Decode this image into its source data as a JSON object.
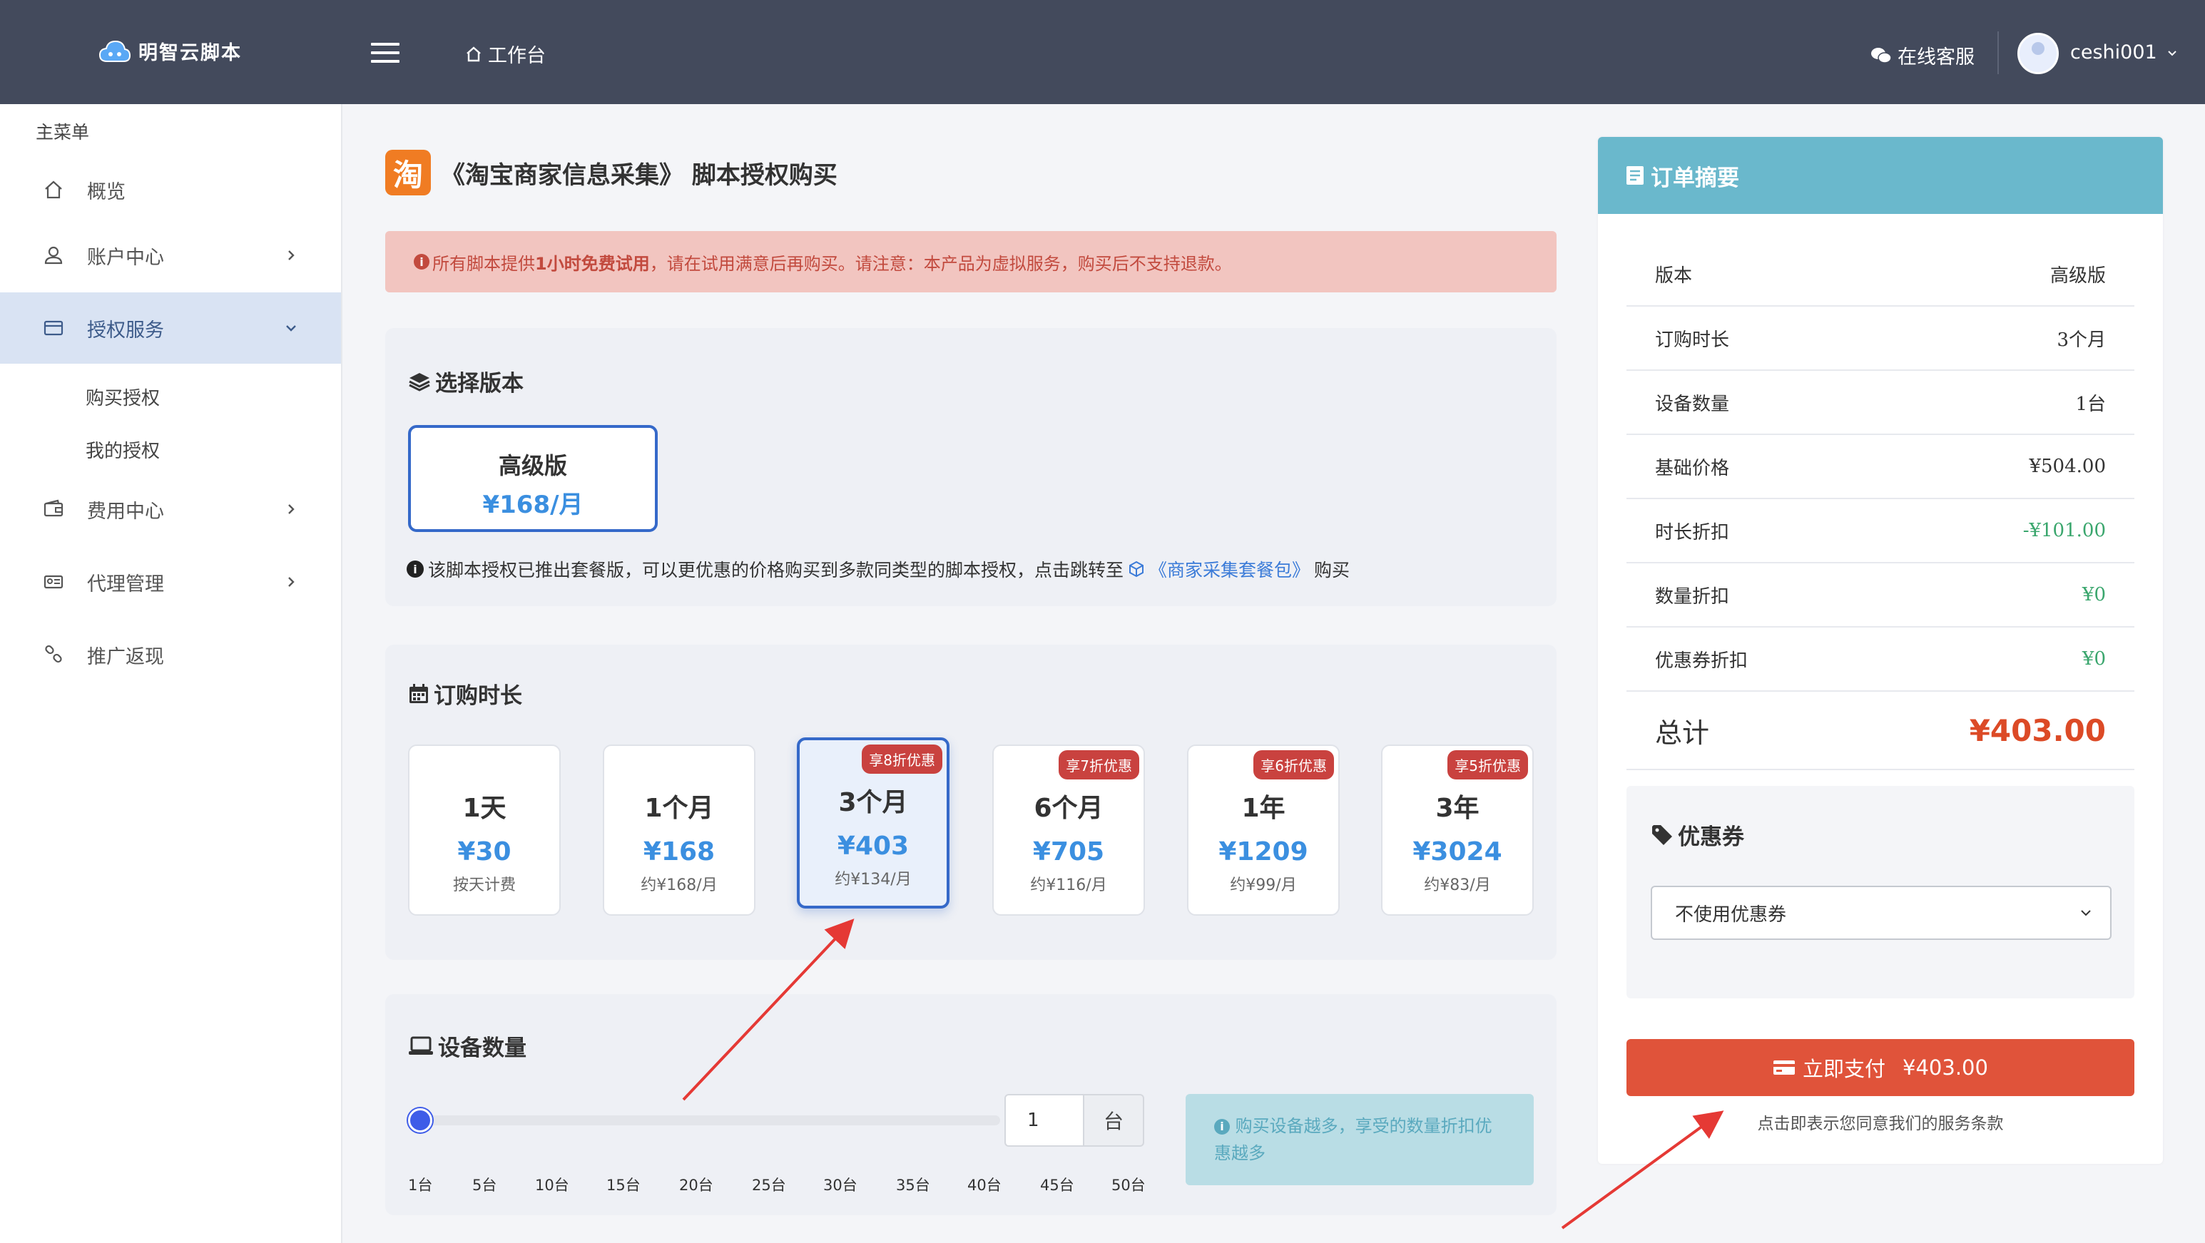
{
  "header": {
    "brand": "明智云脚本",
    "workbench": "工作台",
    "support": "在线客服",
    "username": "ceshi001"
  },
  "sidebar": {
    "title": "主菜单",
    "items": [
      {
        "label": "概览"
      },
      {
        "label": "账户中心"
      },
      {
        "label": "授权服务"
      },
      {
        "label": "费用中心"
      },
      {
        "label": "代理管理"
      },
      {
        "label": "推广返现"
      }
    ],
    "sub_items": [
      {
        "label": "购买授权"
      },
      {
        "label": "我的授权"
      }
    ]
  },
  "page": {
    "logo_char": "淘",
    "title": "《淘宝商家信息采集》 脚本授权购买"
  },
  "alert": {
    "prefix": "所有脚本提供",
    "bold": "1小时免费试用",
    "suffix": "，请在试用满意后再购买。请注意：本产品为虚拟服务，购买后不支持退款。"
  },
  "version": {
    "section_title": "选择版本",
    "name": "高级版",
    "price": "¥168/月",
    "note_prefix": "该脚本授权已推出套餐版，可以更优惠的价格购买到多款同类型的脚本授权，点击跳转至",
    "note_link": "《商家采集套餐包》",
    "note_suffix": "购买"
  },
  "duration": {
    "section_title": "订购时长",
    "options": [
      {
        "label": "1天",
        "price": "¥30",
        "sub": "按天计费",
        "badge": ""
      },
      {
        "label": "1个月",
        "price": "¥168",
        "sub": "约¥168/月",
        "badge": ""
      },
      {
        "label": "3个月",
        "price": "¥403",
        "sub": "约¥134/月",
        "badge": "享8折优惠"
      },
      {
        "label": "6个月",
        "price": "¥705",
        "sub": "约¥116/月",
        "badge": "享7折优惠"
      },
      {
        "label": "1年",
        "price": "¥1209",
        "sub": "约¥99/月",
        "badge": "享6折优惠"
      },
      {
        "label": "3年",
        "price": "¥3024",
        "sub": "约¥83/月",
        "badge": "享5折优惠"
      }
    ],
    "selected_index": 2
  },
  "devices": {
    "section_title": "设备数量",
    "value": "1",
    "unit": "台",
    "slider_value": 1,
    "slider_min": 1,
    "slider_max": 50,
    "ticks": [
      "1台",
      "5台",
      "10台",
      "15台",
      "20台",
      "25台",
      "30台",
      "35台",
      "40台",
      "45台",
      "50台"
    ],
    "hint": "购买设备越多，享受的数量折扣优惠越多"
  },
  "summary": {
    "title": "订单摘要",
    "rows": [
      {
        "label": "版本",
        "value": "高级版",
        "style": "normal"
      },
      {
        "label": "订购时长",
        "value": "3个月",
        "style": "normal"
      },
      {
        "label": "设备数量",
        "value": "1台",
        "style": "normal"
      },
      {
        "label": "基础价格",
        "value": "¥504.00",
        "style": "normal"
      },
      {
        "label": "时长折扣",
        "value": "-¥101.00",
        "style": "green"
      },
      {
        "label": "数量折扣",
        "value": "¥0",
        "style": "green"
      },
      {
        "label": "优惠券折扣",
        "value": "¥0",
        "style": "green"
      }
    ],
    "total_label": "总计",
    "total_value": "¥403.00",
    "coupon_title": "优惠券",
    "coupon_selected": "不使用优惠券",
    "pay_label": "立即支付",
    "pay_amount": "¥403.00",
    "pay_note": "点击即表示您同意我们的服务条款"
  },
  "colors": {
    "topbar": "#434a5c",
    "accent": "#3569c9",
    "price_blue": "#3b8fe0",
    "total_red": "#dc4a26",
    "pay_button": "#e0533a",
    "summary_header": "#6ab8cc",
    "alert_bg": "#f2c5c0",
    "annotation_arrow": "#e53935"
  }
}
